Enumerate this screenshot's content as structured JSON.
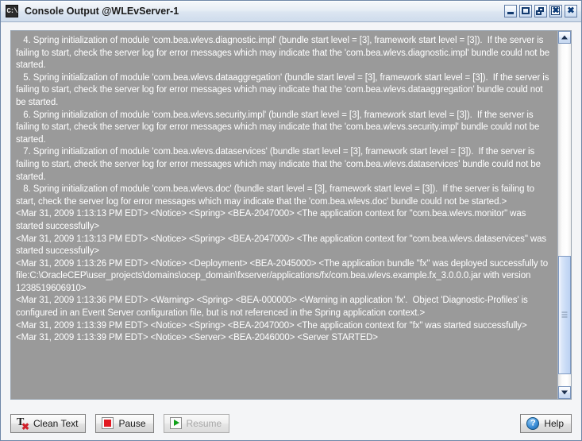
{
  "window": {
    "title": "Console Output @WLEvServer-1",
    "icon": "console-icon",
    "icon_label": "C:\\",
    "buttons": {
      "minimize": "Minimize",
      "maximize": "Maximize",
      "restore": "Restore",
      "close_view": "Close View",
      "close": "Close"
    }
  },
  "console": {
    "lines": [
      "   4. Spring initialization of module 'com.bea.wlevs.diagnostic.impl' (bundle start level = [3], framework start level = [3]).  If the server is failing to start, check the server log for error messages which may indicate that the 'com.bea.wlevs.diagnostic.impl' bundle could not be started.",
      "   5. Spring initialization of module 'com.bea.wlevs.dataaggregation' (bundle start level = [3], framework start level = [3]).  If the server is failing to start, check the server log for error messages which may indicate that the 'com.bea.wlevs.dataaggregation' bundle could not be started.",
      "   6. Spring initialization of module 'com.bea.wlevs.security.impl' (bundle start level = [3], framework start level = [3]).  If the server is failing to start, check the server log for error messages which may indicate that the 'com.bea.wlevs.security.impl' bundle could not be started.",
      "   7. Spring initialization of module 'com.bea.wlevs.dataservices' (bundle start level = [3], framework start level = [3]).  If the server is failing to start, check the server log for error messages which may indicate that the 'com.bea.wlevs.dataservices' bundle could not be started.",
      "   8. Spring initialization of module 'com.bea.wlevs.doc' (bundle start level = [3], framework start level = [3]).  If the server is failing to start, check the server log for error messages which may indicate that the 'com.bea.wlevs.doc' bundle could not be started.>",
      "<Mar 31, 2009 1:13:13 PM EDT> <Notice> <Spring> <BEA-2047000> <The application context for \"com.bea.wlevs.monitor\" was started successfully>",
      "<Mar 31, 2009 1:13:13 PM EDT> <Notice> <Spring> <BEA-2047000> <The application context for \"com.bea.wlevs.dataservices\" was started successfully>",
      "<Mar 31, 2009 1:13:26 PM EDT> <Notice> <Deployment> <BEA-2045000> <The application bundle \"fx\" was deployed successfully to file:C:\\OracleCEP\\user_projects\\domains\\ocep_domain\\fxserver/applications/fx/com.bea.wlevs.example.fx_3.0.0.0.jar with version 1238519606910>",
      "<Mar 31, 2009 1:13:36 PM EDT> <Warning> <Spring> <BEA-000000> <Warning in application 'fx'.  Object 'Diagnostic-Profiles' is configured in an Event Server configuration file, but is not referenced in the Spring application context.>",
      "<Mar 31, 2009 1:13:39 PM EDT> <Notice> <Spring> <BEA-2047000> <The application context for \"fx\" was started successfully>",
      "<Mar 31, 2009 1:13:39 PM EDT> <Notice> <Server> <BEA-2046000> <Server STARTED>"
    ]
  },
  "scrollbar": {
    "up_arrow": "scroll-up",
    "down_arrow": "scroll-down",
    "thumb": "scroll-thumb"
  },
  "footer": {
    "clean_text": "Clean Text",
    "pause": "Pause",
    "resume": "Resume",
    "help": "Help",
    "resume_enabled": false
  },
  "colors": {
    "console_bg": "#9a9a9a",
    "console_text": "#ffffff",
    "frame_border": "#6f87a8",
    "titlebar_top": "#f6f8fb",
    "titlebar_bottom": "#cfdcec",
    "pause_red": "#e21a22",
    "resume_green": "#11a11a",
    "help_blue": "#3c8fd8"
  }
}
